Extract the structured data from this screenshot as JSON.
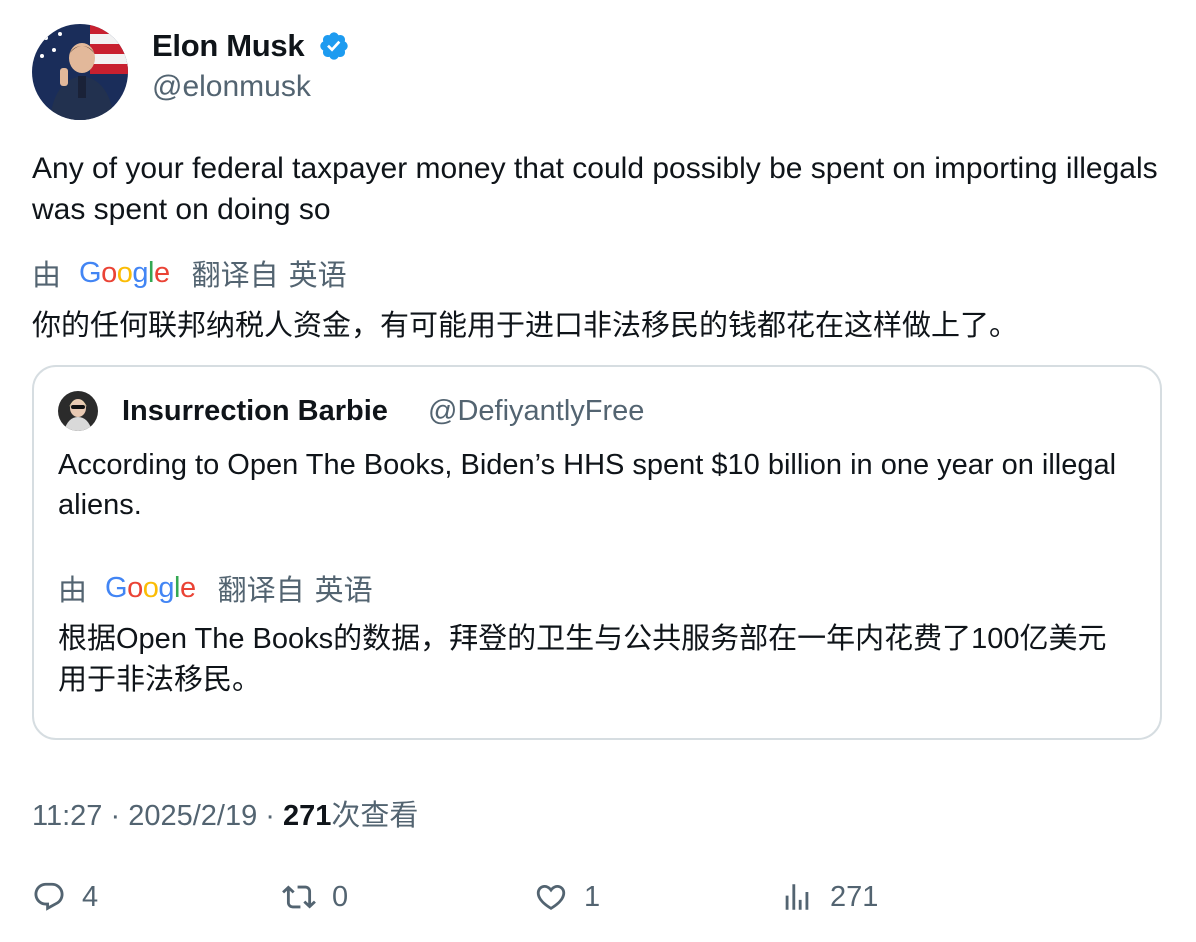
{
  "author": {
    "name": "Elon Musk",
    "handle": "@elonmusk",
    "verified_color": "#1d9bf0"
  },
  "tweet": {
    "text": "Any of your federal taxpayer money that could possibly be spent on importing illegals was spent on doing so",
    "translation": {
      "by": "由",
      "provider": "Google",
      "from_label": "翻译自",
      "language": "英语",
      "text": "你的任何联邦纳税人资金，有可能用于进口非法移民的钱都花在这样做上了。"
    }
  },
  "quoted": {
    "name": "Insurrection Barbie",
    "handle": "@DefiyantlyFree",
    "text": "According to Open The Books, Biden’s HHS spent $10 billion in one year on illegal aliens.",
    "translation": {
      "by": "由",
      "provider": "Google",
      "from_label": "翻译自",
      "language": "英语",
      "text": "根据Open The Books的数据，拜登的卫生与公共服务部在一年内花费了100亿美元用于非法移民。"
    }
  },
  "meta": {
    "time": "11:27",
    "separator": "·",
    "date": "2025/2/19",
    "views_count": "271",
    "views_label": "次查看"
  },
  "actions": {
    "replies": "4",
    "retweets": "0",
    "likes": "1",
    "views": "271"
  },
  "colors": {
    "text": "#0f1419",
    "secondary": "#536471",
    "border": "#d6dde1"
  }
}
